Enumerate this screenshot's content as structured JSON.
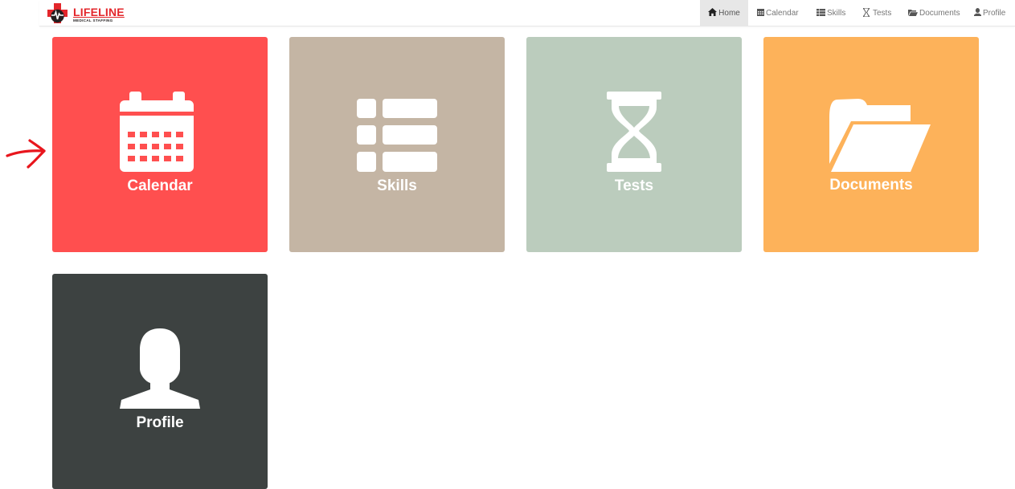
{
  "brand": {
    "name": "LIFELINE",
    "tagline": "MEDICAL STAFFING"
  },
  "nav": {
    "items": [
      {
        "label": "Home",
        "icon": "home-icon",
        "active": true
      },
      {
        "label": "Calendar",
        "icon": "calendar-icon",
        "active": false
      },
      {
        "label": "Skills",
        "icon": "list-icon",
        "active": false
      },
      {
        "label": "Tests",
        "icon": "hourglass-icon",
        "active": false
      },
      {
        "label": "Documents",
        "icon": "folder-open-icon",
        "active": false
      },
      {
        "label": "Profile",
        "icon": "user-icon",
        "active": false
      }
    ]
  },
  "tiles": [
    {
      "label": "Calendar",
      "icon": "calendar-icon",
      "color": "#ff4f4f"
    },
    {
      "label": "Skills",
      "icon": "list-icon",
      "color": "#c4b5a4"
    },
    {
      "label": "Tests",
      "icon": "hourglass-icon",
      "color": "#bbccbd"
    },
    {
      "label": "Documents",
      "icon": "folder-open-icon",
      "color": "#fdb25a"
    },
    {
      "label": "Profile",
      "icon": "user-icon",
      "color": "#3d4241"
    }
  ],
  "annotation": {
    "icon": "red-arrow-icon",
    "color": "#e8161d"
  }
}
